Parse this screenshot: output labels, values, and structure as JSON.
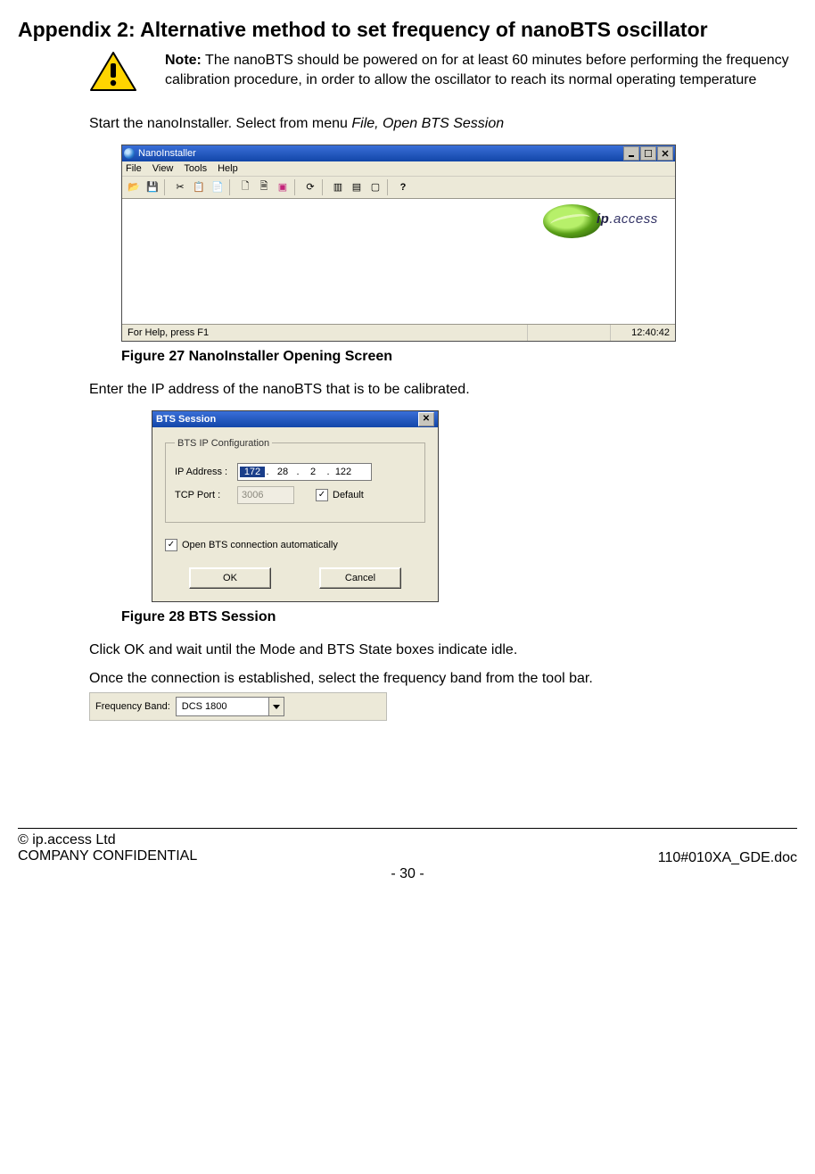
{
  "heading": "Appendix 2:  Alternative method to set frequency of nanoBTS oscillator",
  "note": {
    "label": "Note:",
    "text": " The nanoBTS should be powered on for at least 60 minutes before performing the frequency calibration procedure, in order to allow the oscillator to reach its normal operating temperature"
  },
  "para1_pre": "Start the nanoInstaller. Select from menu ",
  "para1_em": "File, Open BTS Session",
  "fig27": "Figure 27 NanoInstaller Opening Screen",
  "para2": "Enter the IP address of the nanoBTS that is to be calibrated.",
  "fig28": "Figure 28 BTS Session",
  "para3": "Click OK and wait until the Mode and BTS State boxes indicate idle.",
  "para4": "Once the connection is established, select the frequency band from the tool bar.",
  "nano": {
    "title": "NanoInstaller",
    "menus": [
      "File",
      "View",
      "Tools",
      "Help"
    ],
    "logo_ip": "ip",
    "logo_access": ".access",
    "status_left": "For Help, press F1",
    "status_right": "12:40:42"
  },
  "bts": {
    "title": "BTS Session",
    "legend": "BTS IP Configuration",
    "ip_label": "IP Address :",
    "ip": [
      "172",
      "28",
      "2",
      "122"
    ],
    "tcp_label": "TCP Port :",
    "tcp_value": "3006",
    "default_label": "Default",
    "auto_label": "Open BTS connection automatically",
    "ok": "OK",
    "cancel": "Cancel"
  },
  "freq": {
    "label": "Frequency Band:",
    "value": "DCS 1800"
  },
  "footer": {
    "line1": "© ip.access Ltd",
    "line2": "COMPANY CONFIDENTIAL",
    "doc": "110#010XA_GDE.doc",
    "page": "- 30 -"
  }
}
